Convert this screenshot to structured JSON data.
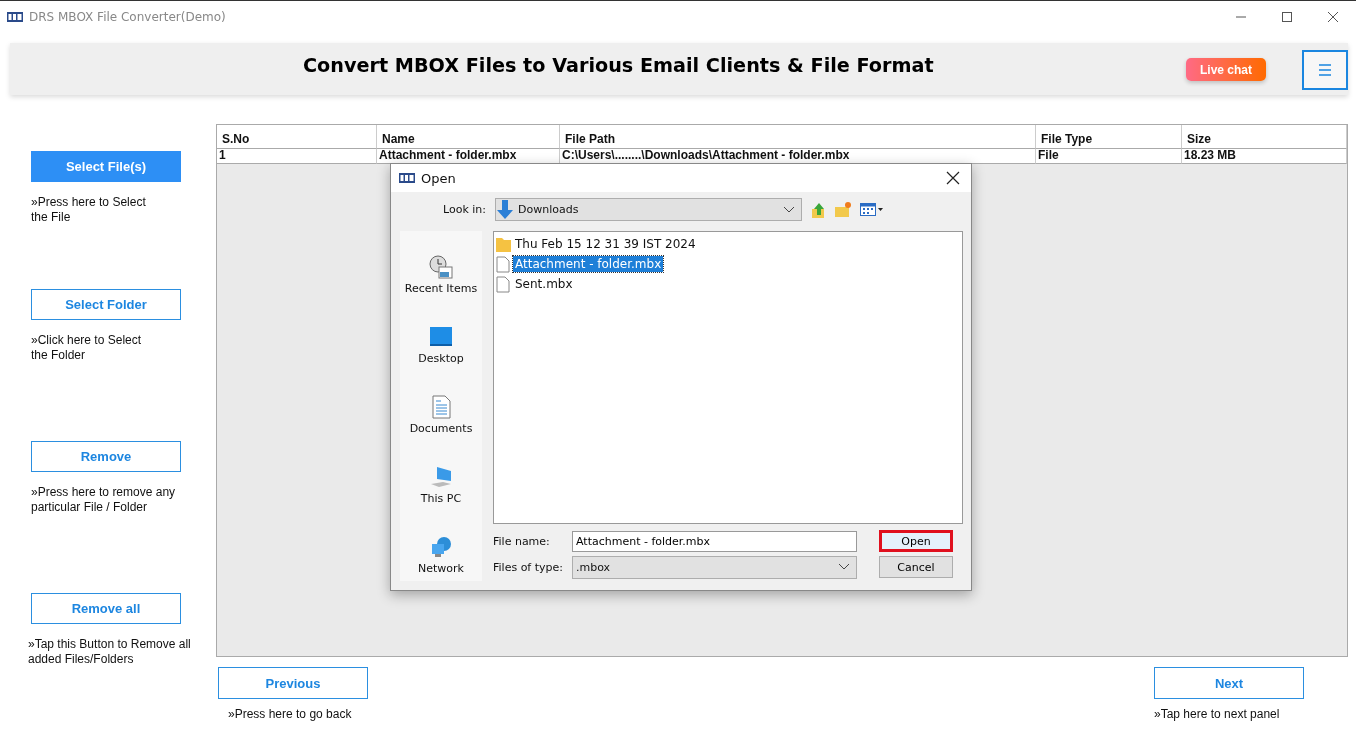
{
  "window": {
    "title": "DRS MBOX File Converter(Demo)"
  },
  "header": {
    "title": "Convert MBOX Files to Various Email Clients & File Format",
    "live_chat": "Live chat"
  },
  "sidebar": {
    "actions": [
      {
        "label": "Select File(s)",
        "hint": "»Press here to Select the File",
        "selected": true
      },
      {
        "label": "Select Folder",
        "hint": "»Click here to Select the Folder",
        "selected": false
      },
      {
        "label": "Remove",
        "hint": "»Press here to remove any particular File / Folder",
        "selected": false
      },
      {
        "label": "Remove all",
        "hint": "»Tap this Button to Remove all added Files/Folders",
        "selected": false
      }
    ]
  },
  "table": {
    "columns": [
      "S.No",
      "Name",
      "File Path",
      "File Type",
      "Size"
    ],
    "rows": [
      [
        "1",
        "Attachment - folder.mbx",
        "C:\\Users\\........\\Downloads\\Attachment - folder.mbx",
        "File",
        "18.23 MB"
      ]
    ]
  },
  "navigation": {
    "previous": {
      "label": "Previous",
      "hint": "»Press here to go back"
    },
    "next": {
      "label": "Next",
      "hint": "»Tap here to next panel"
    }
  },
  "dialog": {
    "title": "Open",
    "look_in_label": "Look in:",
    "look_in": "Downloads",
    "places": [
      {
        "kind": "recent",
        "label": "Recent Items"
      },
      {
        "kind": "desktop",
        "label": "Desktop"
      },
      {
        "kind": "documents",
        "label": "Documents"
      },
      {
        "kind": "pc",
        "label": "This PC"
      },
      {
        "kind": "network",
        "label": "Network"
      }
    ],
    "files": [
      {
        "kind": "folder",
        "name": "Thu Feb 15 12 31 39 IST 2024",
        "selected": false
      },
      {
        "kind": "file",
        "name": "Attachment - folder.mbx",
        "selected": true
      },
      {
        "kind": "file",
        "name": "Sent.mbx",
        "selected": false
      }
    ],
    "file_name_label": "File name:",
    "file_name": "Attachment - folder.mbx",
    "file_type_label": "Files of type:",
    "file_type": ".mbox",
    "buttons": [
      {
        "label": "Open",
        "highlighted": true
      },
      {
        "label": "Cancel",
        "highlighted": false
      }
    ]
  }
}
